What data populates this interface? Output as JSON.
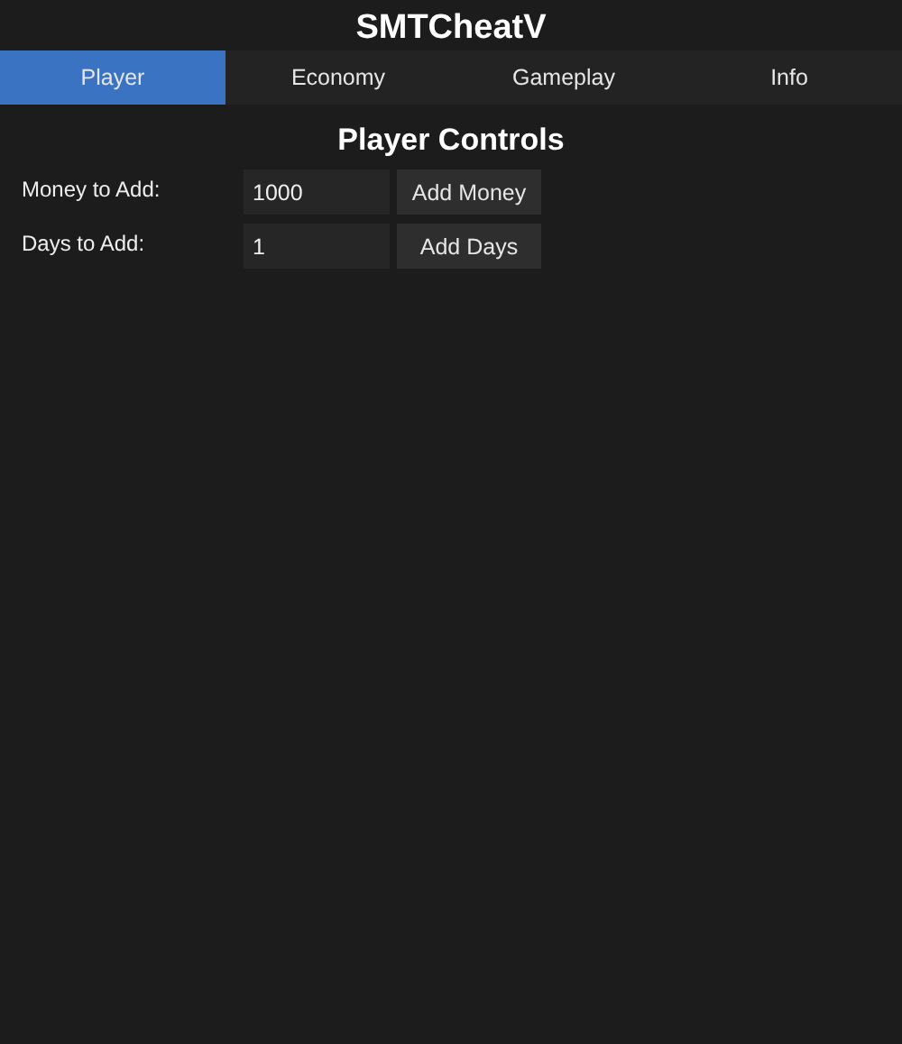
{
  "window": {
    "title": "SMTCheatV"
  },
  "tabs": [
    {
      "label": "Player",
      "selected": true
    },
    {
      "label": "Economy",
      "selected": false
    },
    {
      "label": "Gameplay",
      "selected": false
    },
    {
      "label": "Info",
      "selected": false
    }
  ],
  "panel": {
    "heading": "Player Controls",
    "rows": [
      {
        "label": "Money to Add:",
        "value": "1000",
        "button": "Add Money"
      },
      {
        "label": "Days to Add:",
        "value": "1",
        "button": "Add Days"
      }
    ]
  }
}
